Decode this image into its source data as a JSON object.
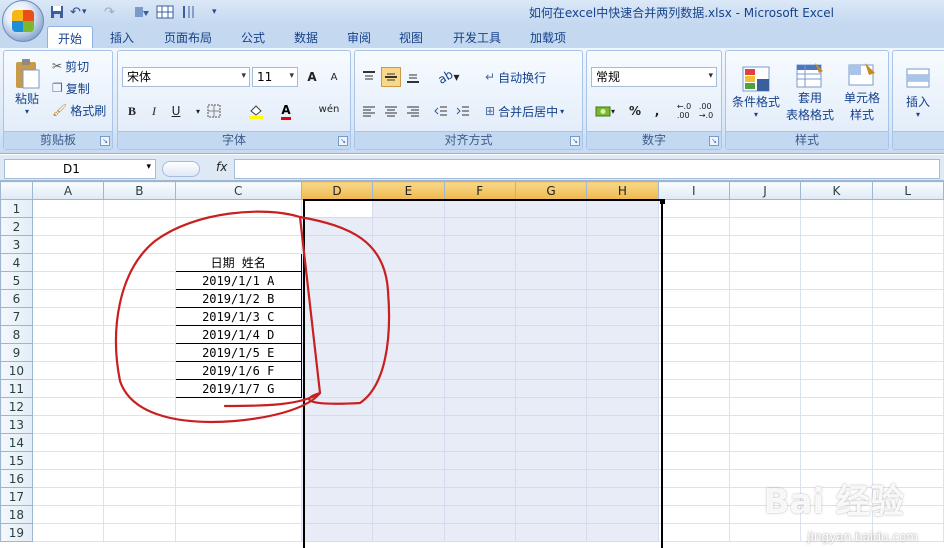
{
  "window": {
    "title": "如何在excel中快速合并两列数据.xlsx - Microsoft Excel"
  },
  "qat": {
    "undo": "↶",
    "redo": "↷",
    "save_icon": "save-icon"
  },
  "tabs": [
    "开始",
    "插入",
    "页面布局",
    "公式",
    "数据",
    "审阅",
    "视图",
    "开发工具",
    "加载项"
  ],
  "clipboard": {
    "paste": "粘贴",
    "cut": "剪切",
    "copy": "复制",
    "format_painter": "格式刷",
    "label": "剪贴板"
  },
  "font": {
    "name": "宋体",
    "size": "11",
    "label": "字体",
    "bold": "B",
    "italic": "I",
    "underline": "U",
    "grow": "A",
    "shrink": "A",
    "phonetic": "wén"
  },
  "alignment": {
    "wrap": "自动换行",
    "merge": "合并后居中",
    "label": "对齐方式"
  },
  "number": {
    "format": "常规",
    "percent": "%",
    "comma": ",",
    "label": "数字"
  },
  "styles": {
    "cond": "条件格式",
    "table1": "套用",
    "table2": "表格格式",
    "cell1": "单元格",
    "cell2": "样式",
    "label": "样式"
  },
  "cells": {
    "insert": "插入"
  },
  "formula_bar": {
    "name_box": "D1",
    "fx": "fx",
    "value": ""
  },
  "columns": [
    "A",
    "B",
    "C",
    "D",
    "E",
    "F",
    "G",
    "H",
    "I",
    "J",
    "K",
    "L"
  ],
  "rows": [
    "1",
    "2",
    "3",
    "4",
    "5",
    "6",
    "7",
    "8",
    "9",
    "10",
    "11",
    "12",
    "13",
    "14",
    "15",
    "16",
    "17",
    "18",
    "19"
  ],
  "table": {
    "header": "日期 姓名",
    "rows": [
      "2019/1/1 A",
      "2019/1/2 B",
      "2019/1/3 C",
      "2019/1/4 D",
      "2019/1/5 E",
      "2019/1/6 F",
      "2019/1/7 G"
    ]
  },
  "watermark": {
    "brand": "Bai 经验",
    "url": "jingyan.baidu.com"
  }
}
